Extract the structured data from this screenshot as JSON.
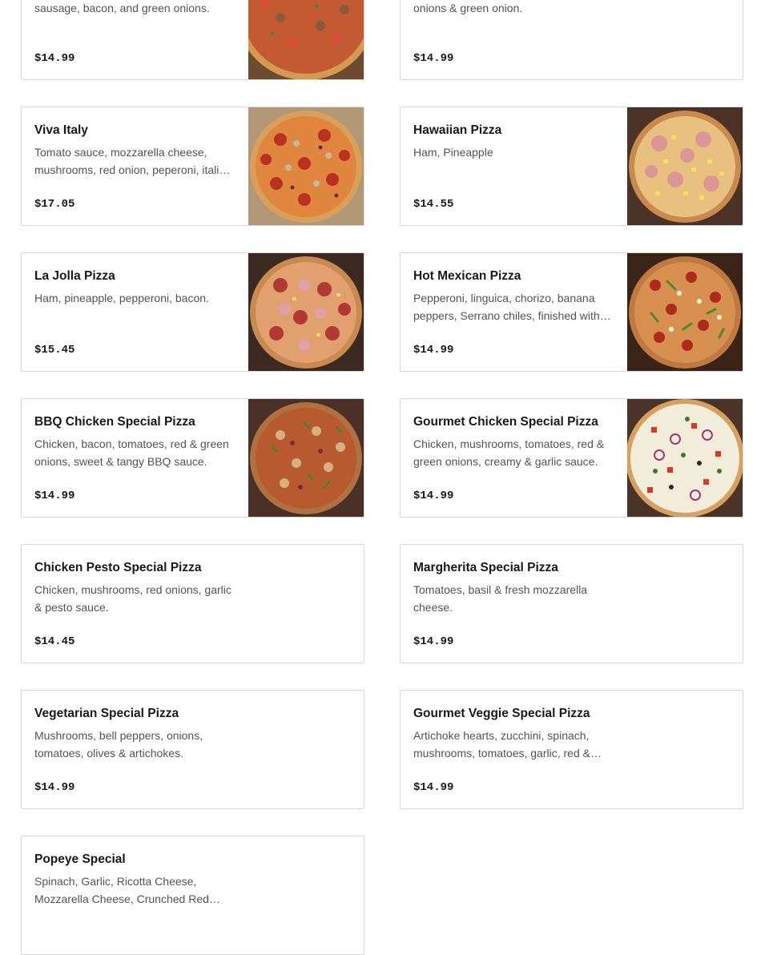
{
  "menu_items": [
    {
      "name": "",
      "description": "Pepperoni, mushrooms, tomatoes, sausage, bacon, and green onions.",
      "price": "$14.99",
      "image": "pizza-photo-supreme"
    },
    {
      "name": "",
      "description": "Pepperoni, mushrooms, linguica, sausage, bacon, tomatoes, onions & green onion.",
      "price": "$14.99",
      "image": null
    },
    {
      "name": "Viva Italy",
      "description": "Tomato sauce, mozzarella cheese, mushrooms, red onion, peperoni, italian sausage",
      "price": "$17.05",
      "image": "pizza-photo-viva-italy"
    },
    {
      "name": "Hawaiian Pizza",
      "description": "Ham, Pineapple",
      "price": "$14.55",
      "image": "pizza-photo-hawaiian"
    },
    {
      "name": "La Jolla Pizza",
      "description": "Ham, pineapple, pepperoni, bacon.",
      "price": "$15.45",
      "image": "pizza-photo-la-jolla"
    },
    {
      "name": "Hot Mexican Pizza",
      "description": "Pepperoni, linguica, chorizo, banana peppers, Serrano chiles, finished with cilantro",
      "price": "$14.99",
      "image": "pizza-photo-hot-mexican"
    },
    {
      "name": "BBQ Chicken Special Pizza",
      "description": "Chicken, bacon, tomatoes, red & green onions, sweet & tangy BBQ sauce.",
      "price": "$14.99",
      "image": "pizza-photo-bbq-chicken"
    },
    {
      "name": "Gourmet Chicken Special Pizza",
      "description": "Chicken, mushrooms, tomatoes, red & green onions, creamy & garlic sauce.",
      "price": "$14.99",
      "image": "pizza-photo-gourmet-chicken"
    },
    {
      "name": "Chicken Pesto Special Pizza",
      "description": "Chicken, mushrooms, red onions, garlic & pesto sauce.",
      "price": "$14.45",
      "image": null
    },
    {
      "name": "Margherita Special Pizza",
      "description": "Tomatoes, basil & fresh mozzarella cheese.",
      "price": "$14.99",
      "image": null
    },
    {
      "name": "Vegetarian Special Pizza",
      "description": "Mushrooms, bell peppers, onions, tomatoes, olives & artichokes.",
      "price": "$14.99",
      "image": null
    },
    {
      "name": "Gourmet Veggie Special Pizza",
      "description": "Artichoke hearts, zucchini, spinach, mushrooms, tomatoes, garlic, red & green onions",
      "price": "$14.99",
      "image": null
    },
    {
      "name": "Popeye Special",
      "description": "Spinach, Garlic, Ricotta Cheese, Mozzarella Cheese, Crunched Red Pepper",
      "price": "",
      "image": null
    }
  ]
}
